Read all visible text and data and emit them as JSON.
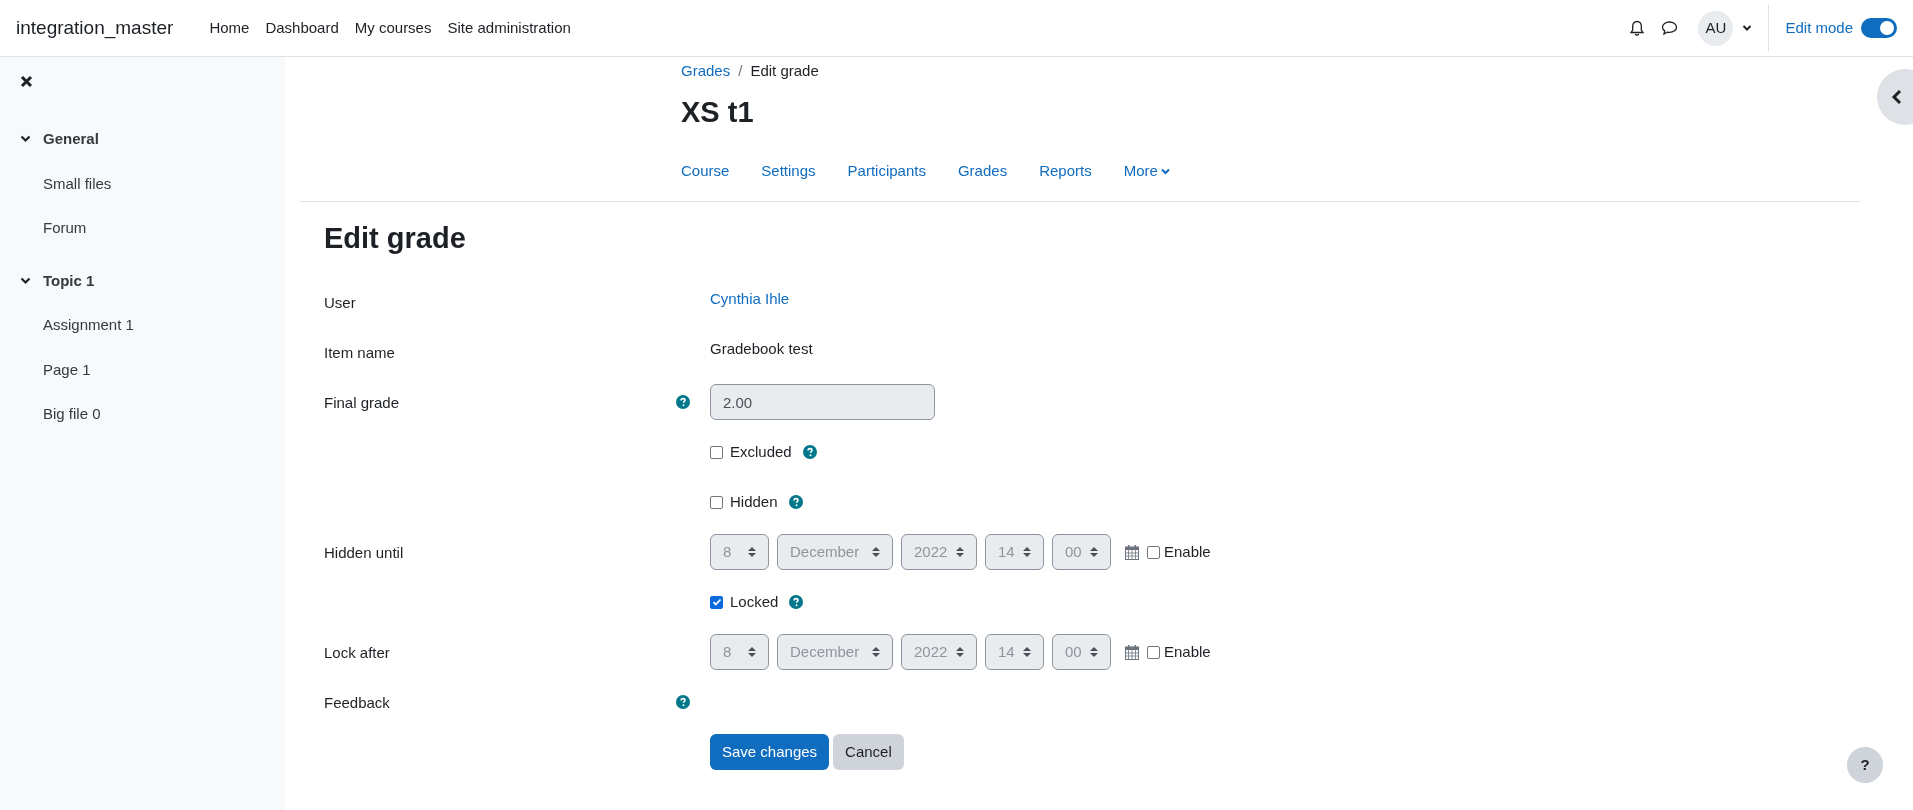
{
  "navbar": {
    "site_name": "integration_master",
    "links": [
      "Home",
      "Dashboard",
      "My courses",
      "Site administration"
    ],
    "avatar": "AU",
    "edit_mode": {
      "label": "Edit mode",
      "on": true
    }
  },
  "sidebar": {
    "sections": [
      {
        "title": "General",
        "expanded": true,
        "items": [
          "Small files",
          "Forum"
        ]
      },
      {
        "title": "Topic 1",
        "expanded": true,
        "items": [
          "Assignment 1",
          "Page 1",
          "Big file 0"
        ]
      }
    ]
  },
  "breadcrumb": [
    {
      "label": "Grades",
      "link": true
    },
    {
      "separator": "/"
    },
    {
      "label": "Edit grade",
      "link": false
    }
  ],
  "course_title": "XS t1",
  "course_nav": [
    "Course",
    "Settings",
    "Participants",
    "Grades",
    "Reports",
    "More"
  ],
  "heading": "Edit grade",
  "form": [
    {
      "kind": "link",
      "label": "User",
      "value": "Cynthia Ihle"
    },
    {
      "kind": "text",
      "label": "Item name",
      "value": "Gradebook test"
    },
    {
      "kind": "input",
      "label": "Final grade",
      "help": true,
      "value": "2.00",
      "disabled": true
    },
    {
      "kind": "checkbox",
      "option": "Excluded",
      "checked": false,
      "option_help": true
    },
    {
      "kind": "checkbox",
      "option": "Hidden",
      "checked": false,
      "option_help": true
    },
    {
      "kind": "date",
      "label": "Hidden until",
      "parts": [
        "8",
        "December",
        "2022",
        "14",
        "00"
      ],
      "enable_label": "Enable",
      "enabled": false
    },
    {
      "kind": "checkbox",
      "option": "Locked",
      "checked": true,
      "option_help": true
    },
    {
      "kind": "date",
      "label": "Lock after",
      "parts": [
        "8",
        "December",
        "2022",
        "14",
        "00"
      ],
      "enable_label": "Enable",
      "enabled": false
    },
    {
      "kind": "empty",
      "label": "Feedback",
      "help": true
    }
  ],
  "buttons": [
    {
      "label": "Save changes",
      "primary": true
    },
    {
      "label": "Cancel",
      "primary": false
    }
  ],
  "help_button": "?"
}
